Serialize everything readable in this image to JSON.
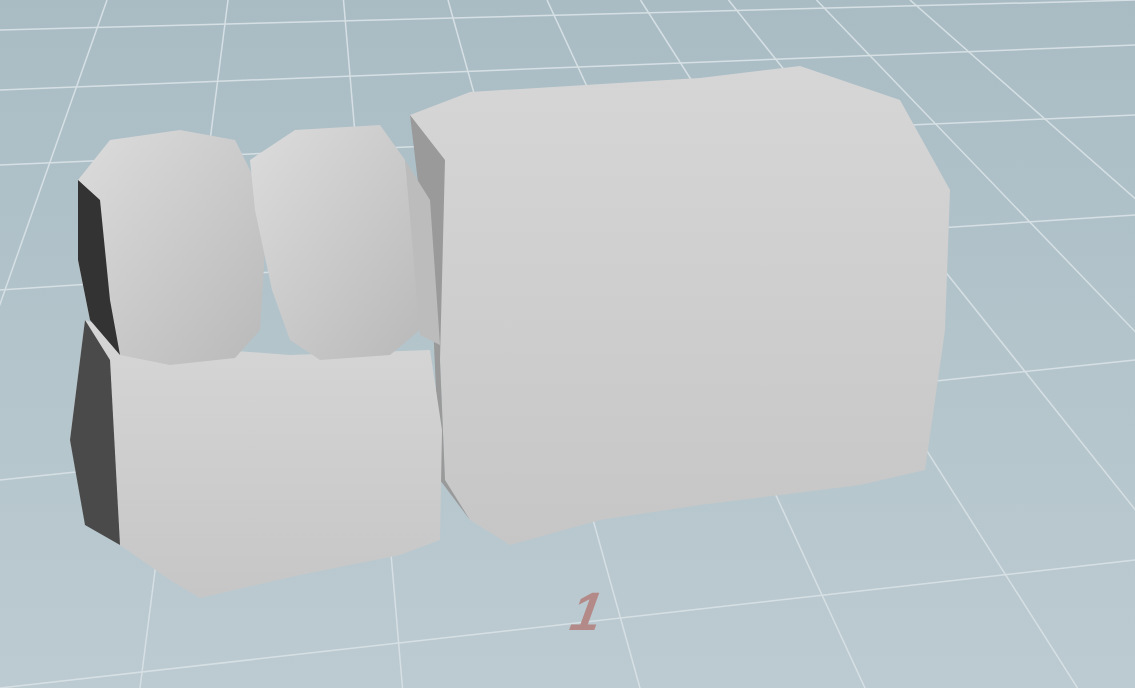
{
  "viewport": {
    "grid_label": "1"
  }
}
